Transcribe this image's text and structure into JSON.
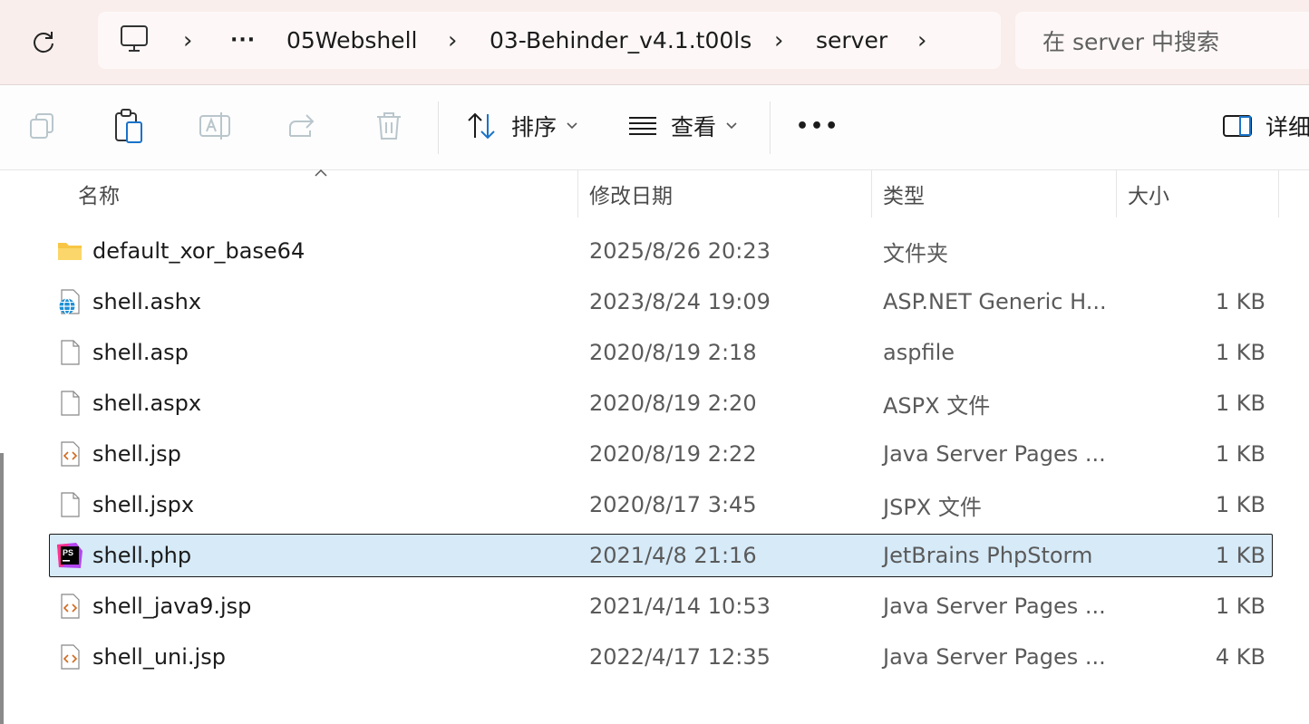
{
  "breadcrumb": {
    "overflow": "···",
    "items": [
      "05Webshell",
      "03-Behinder_v4.1.t00ls",
      "server"
    ]
  },
  "search": {
    "placeholder": "在 server 中搜索"
  },
  "toolbar": {
    "sort_label": "排序",
    "view_label": "查看",
    "more_label": "•••",
    "details_label": "详细"
  },
  "columns": {
    "name": "名称",
    "date": "修改日期",
    "type": "类型",
    "size": "大小"
  },
  "files": [
    {
      "name": "default_xor_base64",
      "date": "2025/8/26 20:23",
      "type": "文件夹",
      "size": "",
      "icon": "folder-icon"
    },
    {
      "name": "shell.ashx",
      "date": "2023/8/24 19:09",
      "type": "ASP.NET Generic H...",
      "size": "1 KB",
      "icon": "web-file-icon"
    },
    {
      "name": "shell.asp",
      "date": "2020/8/19 2:18",
      "type": "aspfile",
      "size": "1 KB",
      "icon": "blank-file-icon"
    },
    {
      "name": "shell.aspx",
      "date": "2020/8/19 2:20",
      "type": "ASPX 文件",
      "size": "1 KB",
      "icon": "blank-file-icon"
    },
    {
      "name": "shell.jsp",
      "date": "2020/8/19 2:22",
      "type": "Java Server Pages ...",
      "size": "1 KB",
      "icon": "code-file-icon"
    },
    {
      "name": "shell.jspx",
      "date": "2020/8/17 3:45",
      "type": "JSPX 文件",
      "size": "1 KB",
      "icon": "blank-file-icon"
    },
    {
      "name": "shell.php",
      "date": "2021/4/8 21:16",
      "type": "JetBrains PhpStorm",
      "size": "1 KB",
      "icon": "phpstorm-icon",
      "selected": true
    },
    {
      "name": "shell_java9.jsp",
      "date": "2021/4/14 10:53",
      "type": "Java Server Pages ...",
      "size": "1 KB",
      "icon": "code-file-icon"
    },
    {
      "name": "shell_uni.jsp",
      "date": "2022/4/17 12:35",
      "type": "Java Server Pages ...",
      "size": "4 KB",
      "icon": "code-file-icon"
    }
  ],
  "phpstorm_badge": "PS",
  "colors": {
    "selection": "#d6eaf8",
    "titlebar": "#f9eeec",
    "folder": "#f8c644"
  }
}
